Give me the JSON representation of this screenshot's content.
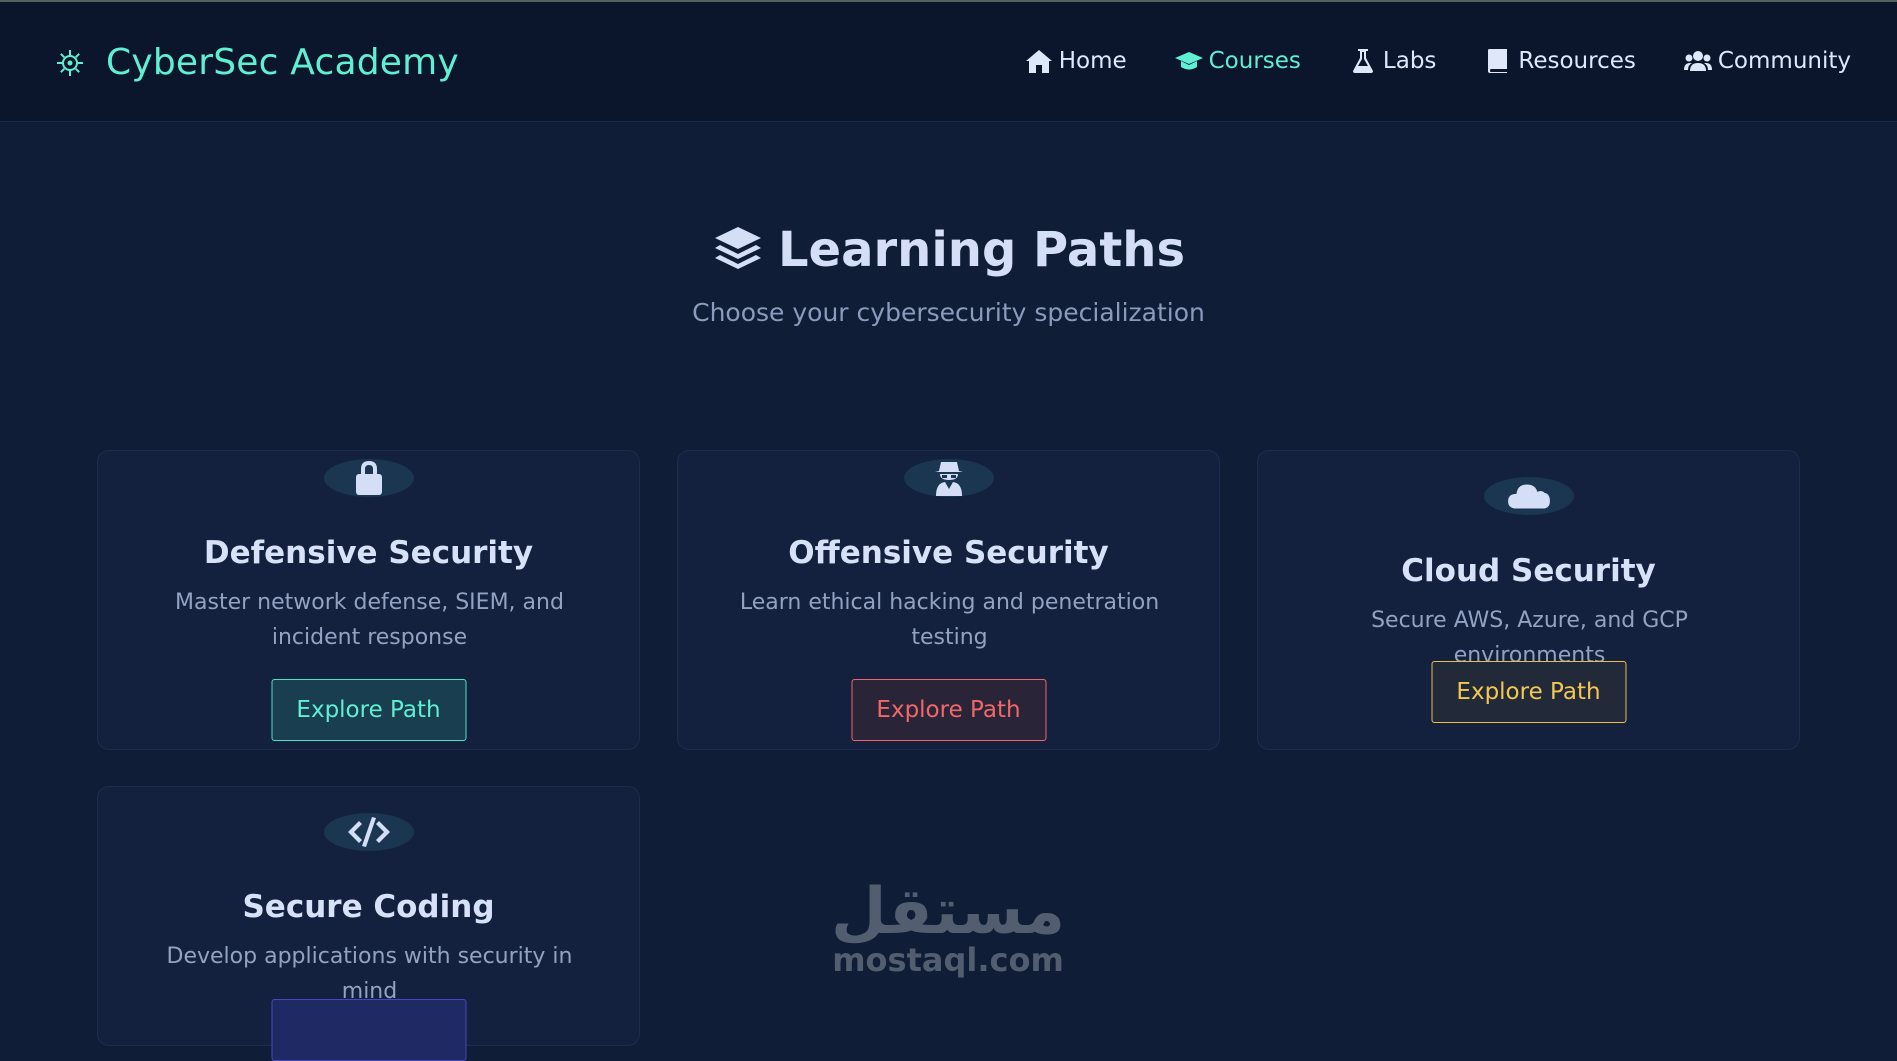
{
  "app": {
    "title": "CyberSec Academy",
    "logo_icon": "virus-gear-icon"
  },
  "nav": {
    "items": [
      {
        "label": "Home",
        "icon": "home-icon",
        "active": false
      },
      {
        "label": "Courses",
        "icon": "graduation-cap-icon",
        "active": true
      },
      {
        "label": "Labs",
        "icon": "flask-icon",
        "active": false
      },
      {
        "label": "Resources",
        "icon": "book-icon",
        "active": false
      },
      {
        "label": "Community",
        "icon": "users-icon",
        "active": false
      }
    ]
  },
  "hero": {
    "icon": "layers-icon",
    "title": "Learning Paths",
    "subtitle": "Choose your cybersecurity specialization"
  },
  "cards": [
    {
      "icon": "lock-icon",
      "title": "Defensive Security",
      "description": "Master network defense, SIEM, and incident response",
      "button": "Explore Path",
      "accent": "#5ff0d3"
    },
    {
      "icon": "spy-icon",
      "title": "Offensive Security",
      "description": "Learn ethical hacking and penetration testing",
      "button": "Explore Path",
      "accent": "#f26868"
    },
    {
      "icon": "cloud-icon",
      "title": "Cloud Security",
      "description": "Secure AWS, Azure, and GCP environments",
      "button": "Explore Path",
      "accent": "#f4c752"
    },
    {
      "icon": "code-icon",
      "title": "Secure Coding",
      "description": "Develop applications with security in mind",
      "button": "",
      "accent": "#4b45c2"
    }
  ],
  "watermark": {
    "arabic": "مستقل",
    "latin": "mostaql.com"
  },
  "colors": {
    "background": "#0f1d36",
    "header": "#0b152b",
    "accent": "#5ff0d3"
  }
}
